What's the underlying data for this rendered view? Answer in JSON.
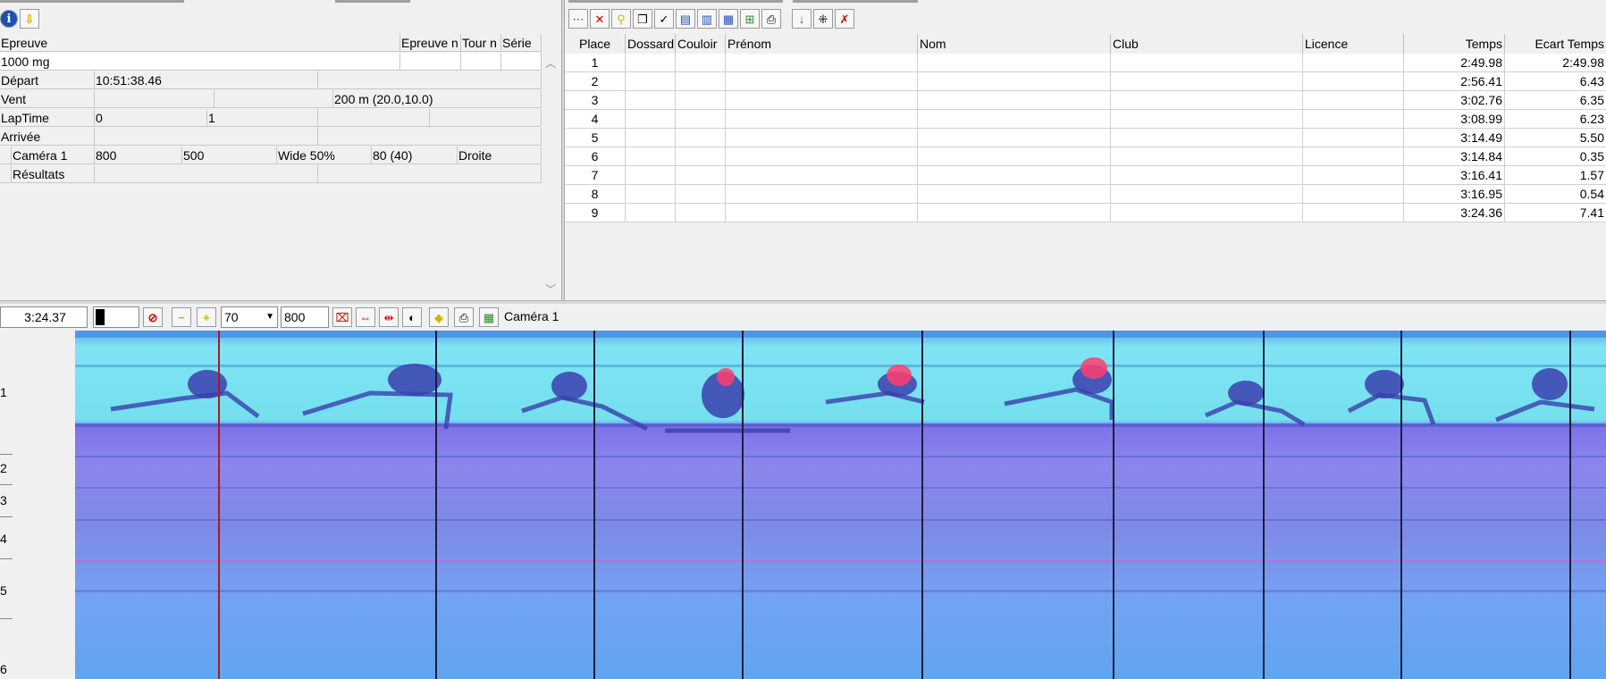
{
  "left_toolbar": {
    "icons": [
      "info-icon",
      "arrow-down-icon"
    ]
  },
  "event_table": {
    "headers": [
      "Epreuve",
      "Epreuve n",
      "Tour n",
      "Série"
    ],
    "event_name": "1000 mg",
    "rows": [
      {
        "label": "Départ",
        "c1": "10:51:38.46",
        "c2": "",
        "c3": "",
        "c4": "",
        "c5": ""
      },
      {
        "label": "Vent",
        "c1": "",
        "c2": "",
        "c3": "200 m (20.0,10.0)",
        "c4": "",
        "c5": ""
      },
      {
        "label": "LapTime",
        "c1": "0",
        "c2": "1",
        "c3": "",
        "c4": "",
        "c5": ""
      },
      {
        "label": "Arrivée",
        "c1": "",
        "c2": "",
        "c3": "",
        "c4": "",
        "c5": ""
      },
      {
        "label": "Caméra 1",
        "c1": "800",
        "c2": "500",
        "c3": "Wide 50%",
        "c4": "80  (40)",
        "c5": "Droite"
      },
      {
        "label": "Résultats",
        "c1": "",
        "c2": "",
        "c3": "",
        "c4": "",
        "c5": ""
      }
    ]
  },
  "results_toolbar": {
    "icons": [
      "select-all-icon",
      "delete-icon",
      "search-icon",
      "copy-icon",
      "check-icon",
      "import-icon",
      "export-icon",
      "send-icon",
      "tree-icon",
      "print-icon",
      "validate-icon",
      "split-icon",
      "cancel-icon"
    ]
  },
  "results": {
    "headers": [
      "Place",
      "Dossard",
      "Couloir",
      "Prénom",
      "Nom",
      "Club",
      "Licence",
      "Temps",
      "Ecart Temps"
    ],
    "rows": [
      {
        "place": "1",
        "temps": "2:49.98",
        "ecart": "2:49.98"
      },
      {
        "place": "2",
        "temps": "2:56.41",
        "ecart": "6.43"
      },
      {
        "place": "3",
        "temps": "3:02.76",
        "ecart": "6.35"
      },
      {
        "place": "4",
        "temps": "3:08.99",
        "ecart": "6.23"
      },
      {
        "place": "5",
        "temps": "3:14.49",
        "ecart": "5.50"
      },
      {
        "place": "6",
        "temps": "3:14.84",
        "ecart": "0.35"
      },
      {
        "place": "7",
        "temps": "3:16.41",
        "ecart": "1.57"
      },
      {
        "place": "8",
        "temps": "3:16.95",
        "ecart": "0.54"
      },
      {
        "place": "9",
        "temps": "3:24.36",
        "ecart": "7.41"
      }
    ]
  },
  "photo_toolbar": {
    "cursor_time": "3:24.37",
    "zoom_value": "70",
    "width_value": "800",
    "camera_label": "Caméra 1",
    "icons": [
      "color-swatch",
      "no-entry-icon",
      "minus-icon",
      "plus-icon",
      "clear-marks-icon",
      "align-icon",
      "measure-icon",
      "contrast-icon",
      "highlight-icon",
      "print-icon",
      "grid-icon"
    ]
  },
  "lanes": [
    "1",
    "2",
    "3",
    "4",
    "5",
    "6"
  ],
  "colors": {
    "photo_track": "#7e8ae6",
    "photo_sky": "#7fe3f3",
    "cursor_line": "#b01818"
  }
}
